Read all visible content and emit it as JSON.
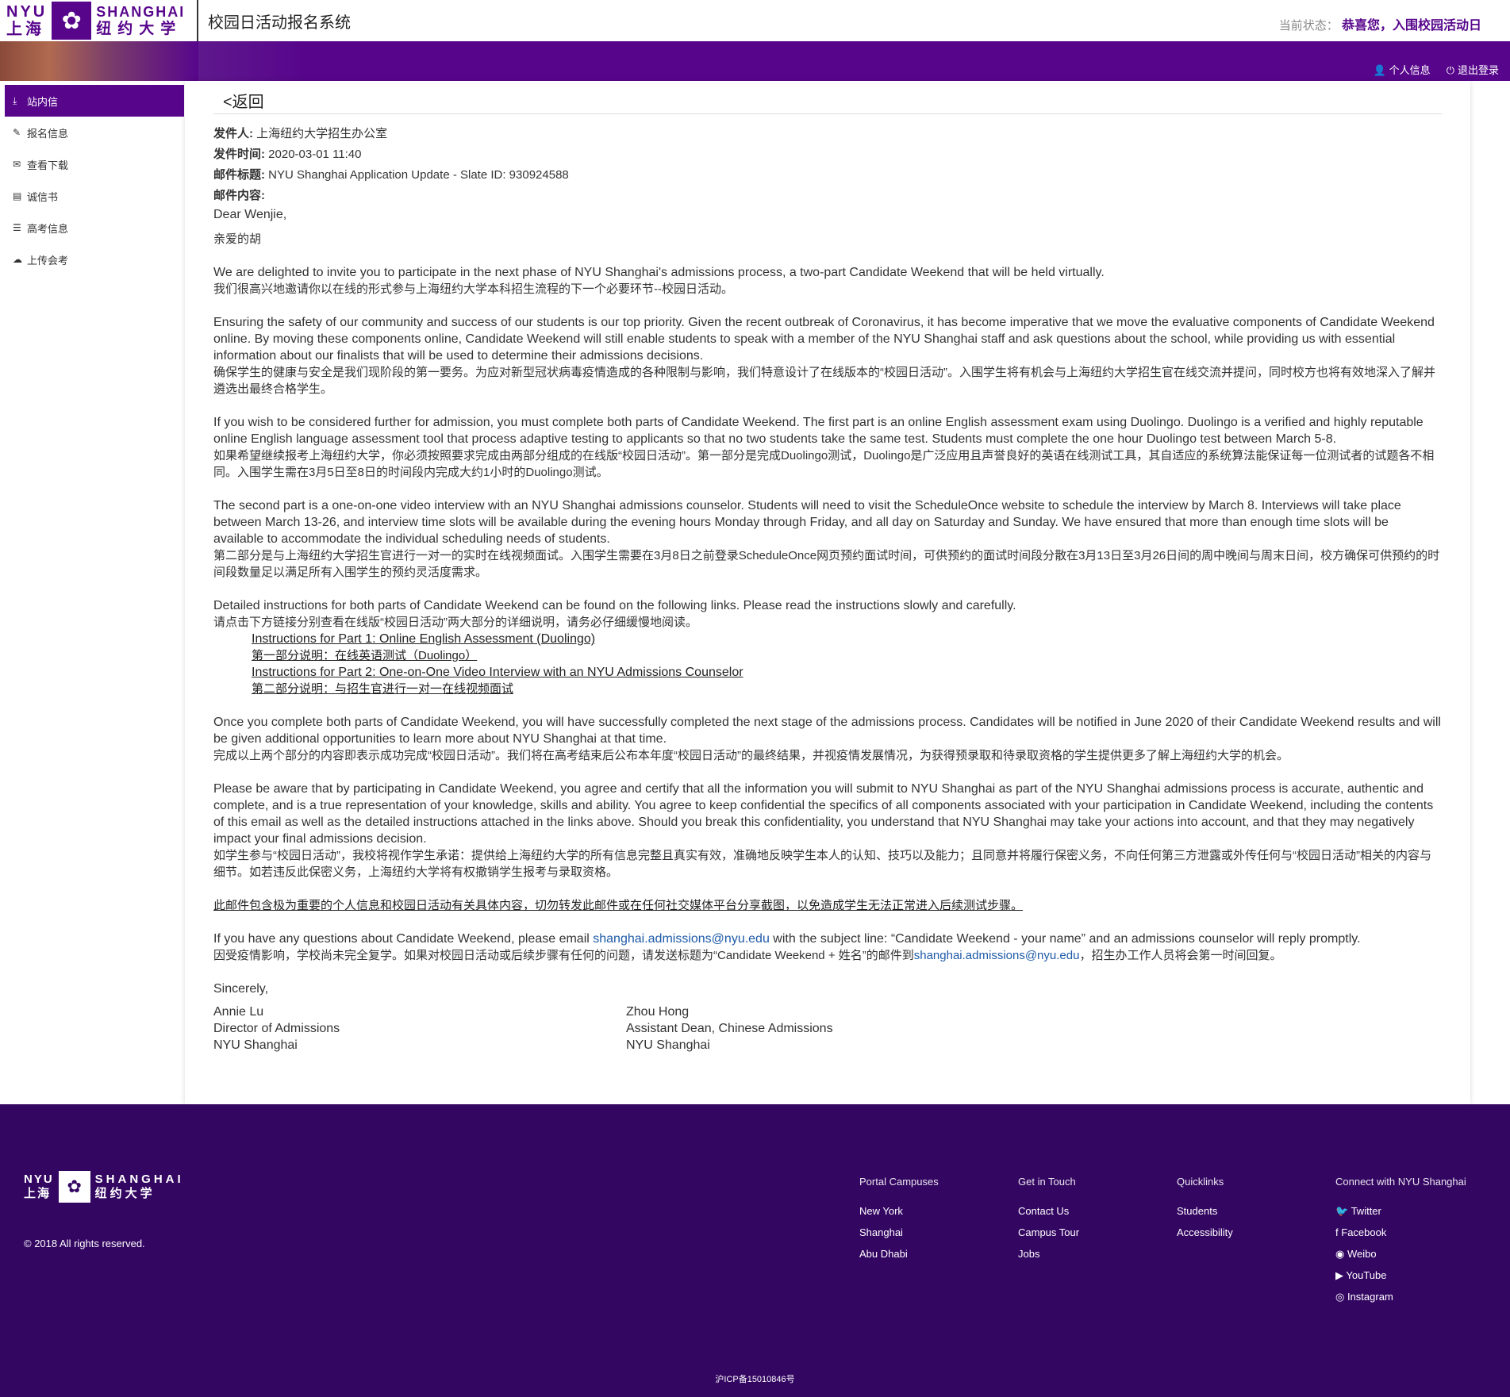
{
  "header": {
    "logo_en_left": "NYU",
    "logo_zh_left": "上海",
    "logo_en_right": "SHANGHAI",
    "logo_zh_right": "纽约大学",
    "system_title": "校园日活动报名系统",
    "status_label": "当前状态：",
    "status_value": "恭喜您，入围校园活动日",
    "profile_link": "个人信息",
    "logout_link": "退出登录"
  },
  "sidebar": {
    "items": [
      {
        "label": "站内信",
        "icon": "download-icon"
      },
      {
        "label": "报名信息",
        "icon": "edit-icon"
      },
      {
        "label": "查看下载",
        "icon": "envelope-icon"
      },
      {
        "label": "诚信书",
        "icon": "file-icon"
      },
      {
        "label": "高考信息",
        "icon": "list-icon"
      },
      {
        "label": "上传会考",
        "icon": "cloud-upload-icon"
      }
    ]
  },
  "message": {
    "back_label": "<返回",
    "sender_label": "发件人:",
    "sender": "上海纽约大学招生办公室",
    "time_label": "发件时间:",
    "time": "2020-03-01 11:40",
    "subject_label": "邮件标题:",
    "subject": "NYU Shanghai Application Update - Slate ID: 930924588",
    "content_label": "邮件内容:",
    "greeting_en": "Dear Wenjie,",
    "greeting_zh": "亲爱的胡",
    "p1_en": "We are delighted to invite you to participate in the next phase of NYU Shanghai's admissions process, a two-part Candidate Weekend that will be held virtually.",
    "p1_zh": "我们很高兴地邀请你以在线的形式参与上海纽约大学本科招生流程的下一个必要环节--校园日活动。",
    "p2_en": "Ensuring the safety of our community and success of our students is our top priority. Given the recent outbreak of Coronavirus, it has become imperative that we move the evaluative components of Candidate Weekend online. By moving these components online, Candidate Weekend will still enable students to speak with a member of the NYU Shanghai staff and ask questions about the school, while providing us with essential information about our finalists that will be used to determine their admissions decisions.",
    "p2_zh": "确保学生的健康与安全是我们现阶段的第一要务。为应对新型冠状病毒疫情造成的各种限制与影响，我们特意设计了在线版本的“校园日活动”。入围学生将有机会与上海纽约大学招生官在线交流并提问，同时校方也将有效地深入了解并遴选出最终合格学生。",
    "p3_en": "If you wish to be considered further for admission, you must complete both parts of Candidate Weekend. The first part is an online English assessment exam using Duolingo. Duolingo is a verified and highly reputable online English language assessment tool that process adaptive testing to applicants so that no two students take the same test. Students must complete the one hour Duolingo test between March 5-8.",
    "p3_zh": "如果希望继续报考上海纽约大学，你必须按照要求完成由两部分组成的在线版“校园日活动”。第一部分是完成Duolingo测试，Duolingo是广泛应用且声誉良好的英语在线测试工具，其自适应的系统算法能保证每一位测试者的试题各不相同。入围学生需在3月5日至8日的时间段内完成大约1小时的Duolingo测试。",
    "p4_en": "The second part is a one-on-one video interview with an NYU Shanghai admissions counselor. Students will need to visit the ScheduleOnce website to schedule the interview by March 8. Interviews will take place between March 13-26, and interview time slots will be available during the evening hours Monday through Friday, and all day on Saturday and Sunday.  We have ensured that more than enough time slots will be available to accommodate the individual scheduling needs of students.",
    "p4_zh": "第二部分是与上海纽约大学招生官进行一对一的实时在线视频面试。入围学生需要在3月8日之前登录ScheduleOnce网页预约面试时间，可供预约的面试时间段分散在3月13日至3月26日间的周中晚间与周末日间，校方确保可供预约的时间段数量足以满足所有入围学生的预约灵活度需求。",
    "p5_en": "Detailed instructions for both parts of Candidate Weekend can be found on the following links.  Please read the instructions slowly and carefully.",
    "p5_zh": "请点击下方链接分别查看在线版“校园日活动”两大部分的详细说明，请务必仔细缓慢地阅读。",
    "link1": "Instructions for Part 1: Online English Assessment (Duolingo)",
    "link2": "第一部分说明：在线英语测试（Duolingo）",
    "link3": "Instructions for Part 2: One-on-One Video Interview with an NYU Admissions Counselor",
    "link4": "第二部分说明：与招生官进行一对一在线视频面试",
    "p6_en": "Once you complete both parts of Candidate Weekend, you will have successfully completed the next stage of the admissions process. Candidates will be notified in June 2020 of their Candidate Weekend results and will be given additional opportunities to learn more about NYU Shanghai at that time.",
    "p6_zh": "完成以上两个部分的内容即表示成功完成“校园日活动”。我们将在高考结束后公布本年度“校园日活动”的最终结果，并视疫情发展情况，为获得预录取和待录取资格的学生提供更多了解上海纽约大学的机会。",
    "p7_en": "Please be aware that by participating in Candidate Weekend, you agree and certify that all the information you will submit to NYU Shanghai as part of the NYU Shanghai admissions process is accurate, authentic and complete, and is a true representation of your knowledge, skills and ability. You agree to keep confidential the specifics of all components associated with your participation in Candidate Weekend, including the contents of this email as well as the detailed instructions attached in the links above. Should you break this confidentiality, you understand that NYU Shanghai may take your actions into account, and that they may negatively impact your final admissions decision.",
    "p7_zh": "如学生参与“校园日活动”，我校将视作学生承诺：提供给上海纽约大学的所有信息完整且真实有效，准确地反映学生本人的认知、技巧以及能力；且同意并将履行保密义务，不向任何第三方泄露或外传任何与“校园日活动”相关的内容与细节。如若违反此保密义务，上海纽约大学将有权撤销学生报考与录取资格。",
    "warning": "此邮件包含极为重要的个人信息和校园日活动有关具体内容，切勿转发此邮件或在任何社交媒体平台分享截图，以免造成学生无法正常进入后续测试步骤。",
    "p8_en_a": "If you have any questions about Candidate Weekend, please email ",
    "p8_email": "shanghai.admissions@nyu.edu",
    "p8_en_b": " with the subject line:  “Candidate Weekend - your name”   and an admissions counselor will reply promptly.",
    "p8_zh_a": "因受疫情影响，学校尚未完全复学。如果对校园日活动或后续步骤有任何的问题，请发送标题为“Candidate Weekend + 姓名”的邮件到",
    "p8_zh_b": "，招生办工作人员将会第一时间回复。",
    "closing": "Sincerely,",
    "sig1_name": "Annie Lu",
    "sig1_title": "Director of Admissions",
    "sig1_org": "NYU Shanghai",
    "sig2_name": "Zhou Hong",
    "sig2_title": "Assistant Dean, Chinese Admissions",
    "sig2_org": "NYU Shanghai"
  },
  "footer": {
    "logo_en_left": "NYU",
    "logo_zh_left": "上海",
    "logo_en_right": "SHANGHAI",
    "logo_zh_right": "纽约大学",
    "copyright": "© 2018 All rights reserved.",
    "col1": {
      "heading": "Portal Campuses",
      "items": [
        "New York",
        "Shanghai",
        "Abu Dhabi"
      ]
    },
    "col2": {
      "heading": "Get in Touch",
      "items": [
        "Contact Us",
        "Campus Tour",
        "Jobs"
      ]
    },
    "col3": {
      "heading": "Quicklinks",
      "items": [
        "Students",
        "Accessibility"
      ]
    },
    "col4": {
      "heading": "Connect with NYU Shanghai",
      "items": [
        "Twitter",
        "Facebook",
        "Weibo",
        "YouTube",
        "Instagram"
      ]
    },
    "icp": "沪ICP备15010846号"
  },
  "colors": {
    "brand": "#57068c",
    "footer_bg": "#330662",
    "link": "#1e5aa8"
  }
}
